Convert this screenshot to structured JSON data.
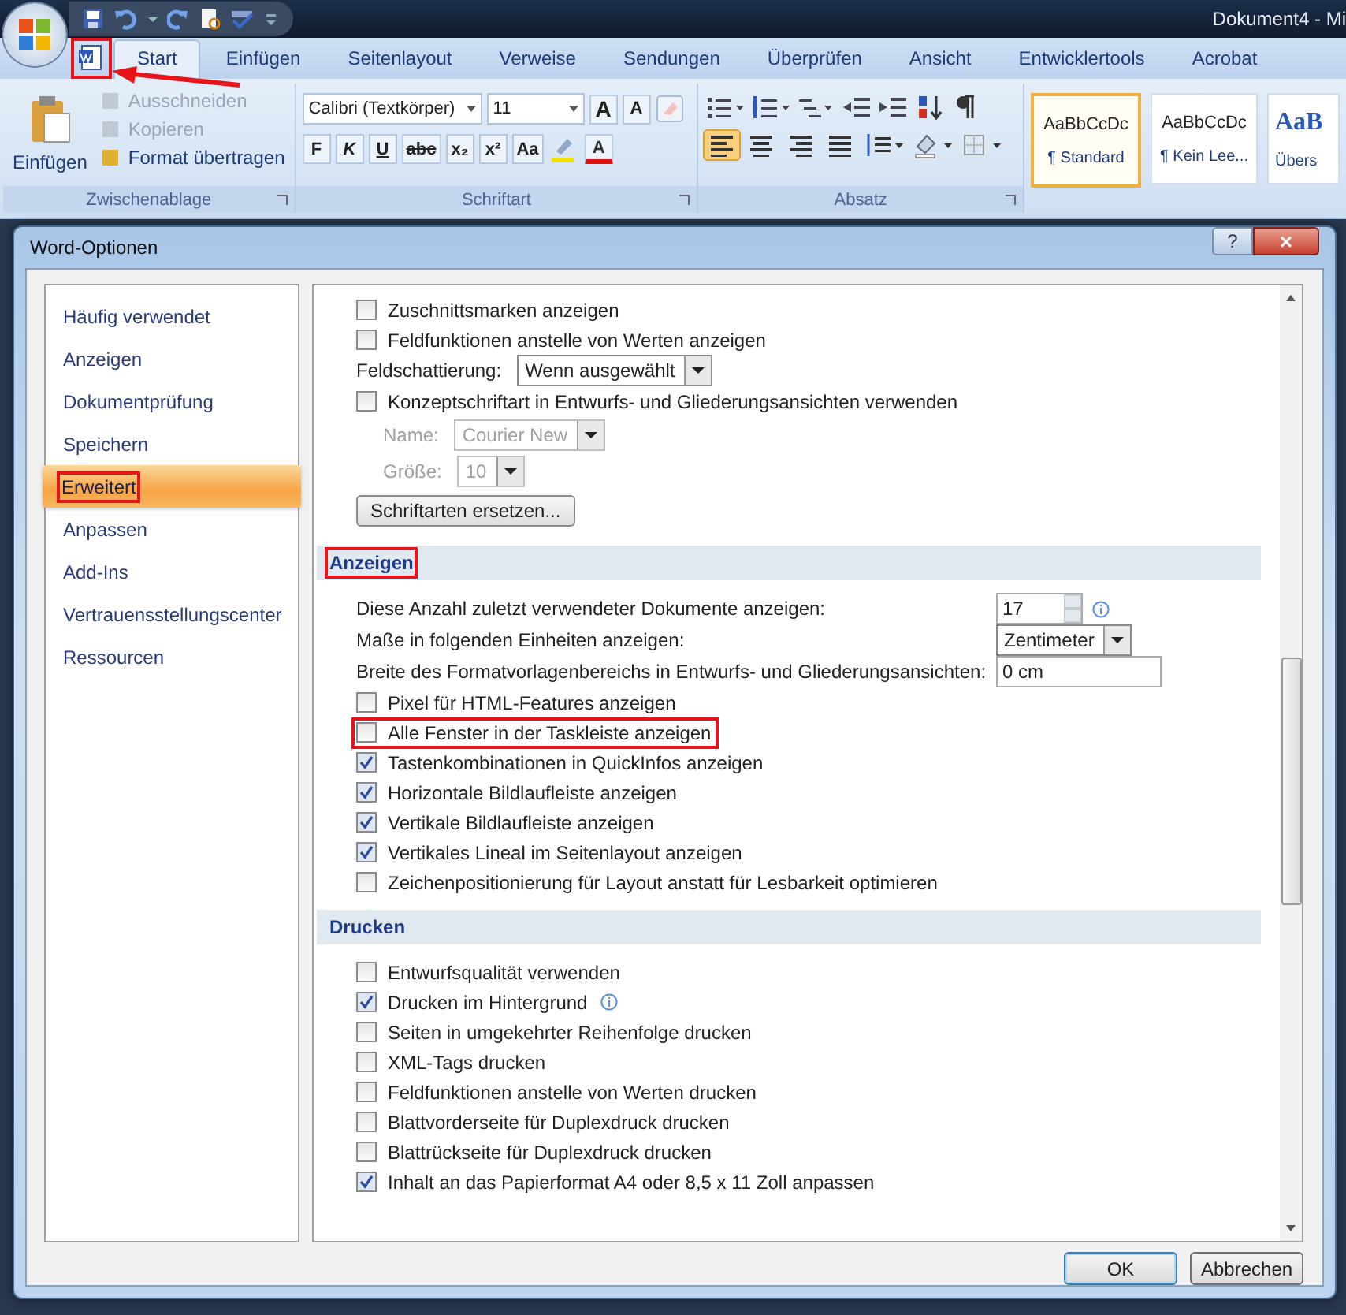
{
  "title_bar": {
    "title": "Dokument4 - Mi"
  },
  "ribbon_tabs": [
    {
      "label": "Start",
      "selected": true
    },
    {
      "label": "Einfügen",
      "selected": false
    },
    {
      "label": "Seitenlayout",
      "selected": false
    },
    {
      "label": "Verweise",
      "selected": false
    },
    {
      "label": "Sendungen",
      "selected": false
    },
    {
      "label": "Überprüfen",
      "selected": false
    },
    {
      "label": "Ansicht",
      "selected": false
    },
    {
      "label": "Entwicklertools",
      "selected": false
    },
    {
      "label": "Acrobat",
      "selected": false
    }
  ],
  "clipboard": {
    "label": "Zwischenablage",
    "paste": "Einfügen",
    "items": [
      {
        "label": "Ausschneiden",
        "disabled": true
      },
      {
        "label": "Kopieren",
        "disabled": true
      },
      {
        "label": "Format übertragen",
        "disabled": false
      }
    ]
  },
  "font": {
    "label": "Schriftart",
    "font_name": "Calibri (Textkörper)",
    "font_size": "11",
    "grow": "A",
    "shrink": "A",
    "format_buttons": [
      "F",
      "K",
      "U",
      "abc",
      "x₂",
      "x²",
      "Aa"
    ],
    "color_button": "A"
  },
  "paragraph": {
    "label": "Absatz",
    "alignments": [
      {
        "selected": true
      },
      {
        "selected": false
      },
      {
        "selected": false
      },
      {
        "selected": false
      }
    ]
  },
  "styles": [
    {
      "preview": "AaBbCcDc",
      "name": "¶ Standard",
      "selected": true
    },
    {
      "preview": "AaBbCcDc",
      "name": "¶ Kein Lee...",
      "selected": false
    },
    {
      "preview": "AaB",
      "name": "Übers",
      "selected": false
    }
  ],
  "dialog": {
    "title": "Word-Optionen",
    "help": "?",
    "close": "×",
    "sidebar": [
      {
        "label": "Häufig verwendet",
        "selected": false,
        "highlighted": false
      },
      {
        "label": "Anzeigen",
        "selected": false,
        "highlighted": false
      },
      {
        "label": "Dokumentprüfung",
        "selected": false,
        "highlighted": false
      },
      {
        "label": "Speichern",
        "selected": false,
        "highlighted": false
      },
      {
        "label": "Erweitert",
        "selected": true,
        "highlighted": true
      },
      {
        "label": "Anpassen",
        "selected": false,
        "highlighted": false
      },
      {
        "label": "Add-Ins",
        "selected": false,
        "highlighted": false
      },
      {
        "label": "Vertrauensstellungscenter",
        "selected": false,
        "highlighted": false
      },
      {
        "label": "Ressourcen",
        "selected": false,
        "highlighted": false
      }
    ],
    "options": [
      {
        "kind": "checkbox",
        "label": "Zuschnittsmarken anzeigen",
        "checked": false
      },
      {
        "kind": "checkbox",
        "label": "Feldfunktionen anstelle von Werten anzeigen",
        "checked": false
      },
      {
        "kind": "select",
        "label": "Feldschattierung:",
        "value": "Wenn ausgewählt",
        "disabled": false
      },
      {
        "kind": "checkbox",
        "label": "Konzeptschriftart in Entwurfs- und Gliederungsansichten verwenden",
        "checked": false
      },
      {
        "kind": "select",
        "label": "Name:",
        "value": "Courier New",
        "disabled": true
      },
      {
        "kind": "select",
        "label": "Größe:",
        "value": "10",
        "disabled": true
      },
      {
        "kind": "button",
        "label": "Schriftarten ersetzen..."
      },
      {
        "kind": "heading",
        "label": "Anzeigen",
        "highlighted": true
      },
      {
        "kind": "spin",
        "label": "Diese Anzahl zuletzt verwendeter Dokumente anzeigen:",
        "value": "17",
        "info": true
      },
      {
        "kind": "dropdown",
        "label": "Maße in folgenden Einheiten anzeigen:",
        "value": "Zentimeter"
      },
      {
        "kind": "field",
        "label": "Breite des Formatvorlagenbereichs in Entwurfs- und Gliederungsansichten:",
        "value": "0 cm"
      },
      {
        "kind": "checkbox",
        "label": "Pixel für HTML-Features anzeigen",
        "checked": false
      },
      {
        "kind": "checkbox",
        "label": "Alle Fenster in der Taskleiste anzeigen",
        "checked": false,
        "highlighted": true
      },
      {
        "kind": "checkbox",
        "label": "Tastenkombinationen in QuickInfos anzeigen",
        "checked": true
      },
      {
        "kind": "checkbox",
        "label": "Horizontale Bildlaufleiste anzeigen",
        "checked": true
      },
      {
        "kind": "checkbox",
        "label": "Vertikale Bildlaufleiste anzeigen",
        "checked": true
      },
      {
        "kind": "checkbox",
        "label": "Vertikales Lineal im Seitenlayout anzeigen",
        "checked": true
      },
      {
        "kind": "checkbox",
        "label": "Zeichenpositionierung für Layout anstatt für Lesbarkeit optimieren",
        "checked": false
      },
      {
        "kind": "heading",
        "label": "Drucken"
      },
      {
        "kind": "checkbox",
        "label": "Entwurfsqualität verwenden",
        "checked": false
      },
      {
        "kind": "checkbox",
        "label": "Drucken im Hintergrund",
        "checked": true,
        "info": true
      },
      {
        "kind": "checkbox",
        "label": "Seiten in umgekehrter Reihenfolge drucken",
        "checked": false
      },
      {
        "kind": "checkbox",
        "label": "XML-Tags drucken",
        "checked": false
      },
      {
        "kind": "checkbox",
        "label": "Feldfunktionen anstelle von Werten drucken",
        "checked": false
      },
      {
        "kind": "checkbox",
        "label": "Blattvorderseite für Duplexdruck drucken",
        "checked": false
      },
      {
        "kind": "checkbox",
        "label": "Blattrückseite für Duplexdruck drucken",
        "checked": false
      },
      {
        "kind": "checkbox",
        "label": "Inhalt an das Papierformat A4 oder 8,5 x 11 Zoll anpassen",
        "checked": true
      }
    ],
    "buttons": [
      {
        "label": "OK",
        "default": true
      },
      {
        "label": "Abbrechen",
        "default": false
      }
    ]
  }
}
